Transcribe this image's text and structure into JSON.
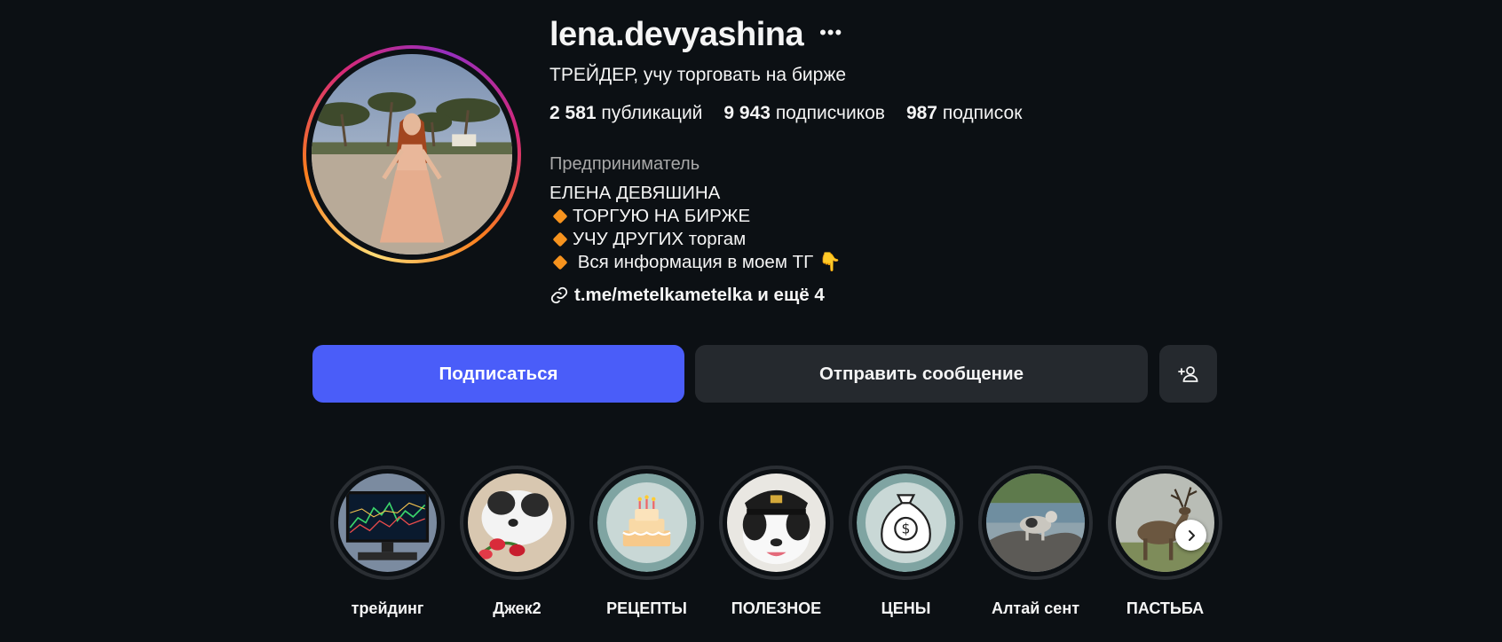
{
  "profile": {
    "username": "lena.devyashina",
    "subtitle": "ТРЕЙДЕР, учу торговать на бирже",
    "stats": [
      {
        "value": "2 581",
        "label": "публикаций"
      },
      {
        "value": "9 943",
        "label": "подписчиков"
      },
      {
        "value": "987",
        "label": "подписок"
      }
    ],
    "category": "Предприниматель",
    "bio": {
      "name_line": "ЕЛЕНА ДЕВЯШИНА",
      "line1": "ТОРГУЮ НА БИРЖЕ",
      "line2": "УЧУ ДРУГИХ торгам",
      "line3": " Вся информация в моем ТГ ",
      "line3_emoji": "👇"
    },
    "link": "t.me/metelkametelka и ещё 4"
  },
  "actions": {
    "follow_label": "Подписаться",
    "message_label": "Отправить сообщение",
    "add_user_icon": "person-plus-icon"
  },
  "highlights": [
    {
      "label": "трейдинг",
      "icon": "trading-monitor"
    },
    {
      "label": "Джек2",
      "icon": "dog-with-flowers"
    },
    {
      "label": "РЕЦЕПТЫ",
      "icon": "cake"
    },
    {
      "label": "ПОЛЕЗНОЕ",
      "icon": "dog-in-cap"
    },
    {
      "label": "ЦЕНЫ",
      "icon": "money-bag"
    },
    {
      "label": "Алтай сент",
      "icon": "dog-on-rock"
    },
    {
      "label": "ПАСТЬБА",
      "icon": "deer"
    }
  ],
  "colors": {
    "background": "#0c1014",
    "follow_button": "#4a5df9",
    "secondary_button": "#25292e",
    "bullet": "#f7931e"
  }
}
